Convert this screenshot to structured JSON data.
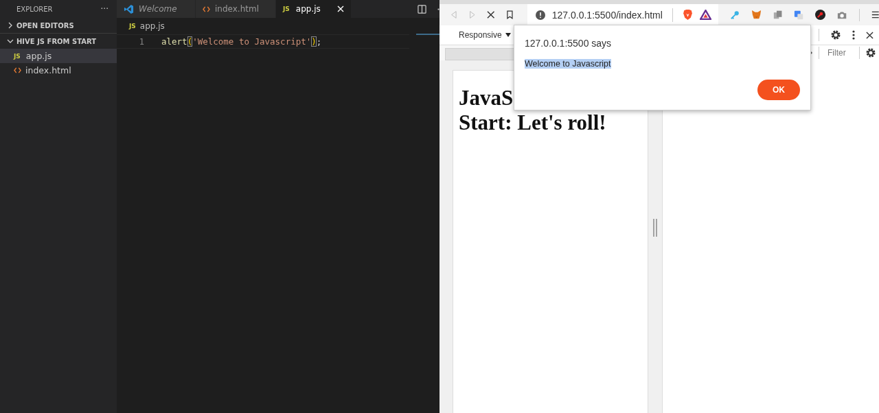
{
  "sidebar": {
    "title": "EXPLORER",
    "more": "···",
    "sections": [
      {
        "label": "OPEN EDITORS",
        "expanded": false
      },
      {
        "label": "HIVE JS FROM START",
        "expanded": true,
        "files": [
          {
            "kind": "js",
            "badge": "JS",
            "name": "app.js",
            "selected": true
          },
          {
            "kind": "html",
            "name": "index.html",
            "selected": false
          }
        ]
      }
    ]
  },
  "tabs": [
    {
      "kind": "vscode",
      "label": "Welcome",
      "preview": true,
      "selected": false
    },
    {
      "kind": "html",
      "label": "index.html",
      "preview": false,
      "selected": false
    },
    {
      "kind": "js",
      "badge": "JS",
      "label": "app.js",
      "preview": false,
      "selected": true
    }
  ],
  "breadcrumb": {
    "badge": "JS",
    "label": "app.js"
  },
  "code_lines": [
    {
      "number": "1",
      "tokens": [
        {
          "text": "alert",
          "kind": "function"
        },
        {
          "text": "(",
          "kind": "bracket"
        },
        {
          "text": "'Welcome to Javascript'",
          "kind": "string"
        },
        {
          "text": ")",
          "kind": "bracket"
        },
        {
          "text": ";",
          "kind": "punct"
        }
      ]
    }
  ],
  "browser": {
    "url": "127.0.0.1:5500/index.html",
    "loading": true,
    "device": "Responsive",
    "filter_placeholder": "Filter",
    "page_heading": [
      "JavaS",
      "Start: Let's roll!"
    ],
    "dialog": {
      "title": "127.0.0.1:5500 says",
      "message": "Welcome to Javascript",
      "message_selected": true,
      "button": "OK"
    }
  }
}
